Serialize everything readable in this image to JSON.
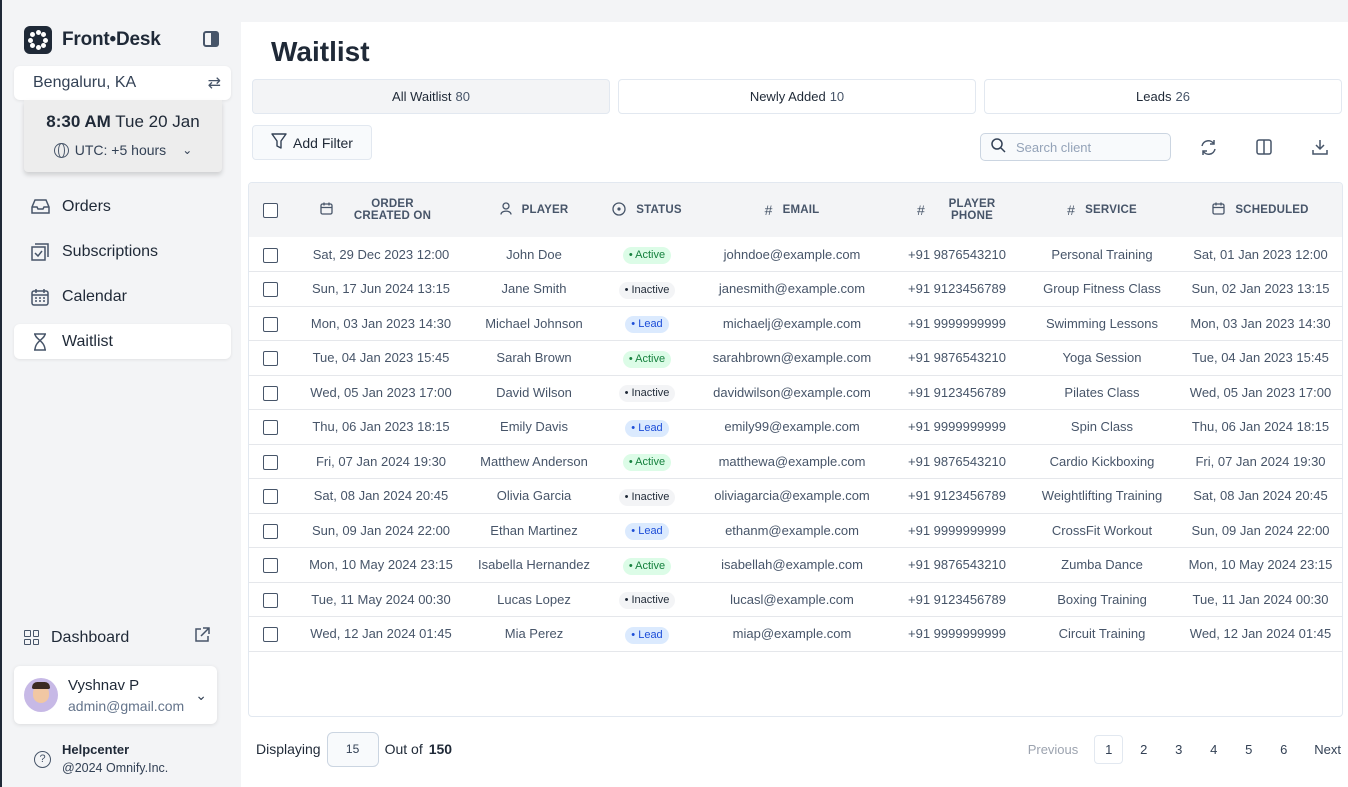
{
  "brand": {
    "name": "Front•Desk"
  },
  "location": "Bengaluru, KA",
  "clock": {
    "time": "8:30 AM",
    "date": "Tue 20 Jan",
    "timezone": "UTC: +5 hours"
  },
  "nav": [
    {
      "label": "Orders",
      "icon": "inbox-icon"
    },
    {
      "label": "Subscriptions",
      "icon": "subscriptions-icon"
    },
    {
      "label": "Calendar",
      "icon": "calendar-icon"
    },
    {
      "label": "Waitlist",
      "icon": "hourglass-icon",
      "active": true
    }
  ],
  "dashboard": {
    "label": "Dashboard"
  },
  "user": {
    "name": "Vyshnav P",
    "email": "admin@gmail.com"
  },
  "help": {
    "title": "Helpcenter",
    "subtitle": "@2024 Omnify.Inc."
  },
  "page": {
    "title": "Waitlist"
  },
  "tabs": [
    {
      "label": "All Waitlist",
      "count": "80",
      "active": true
    },
    {
      "label": "Newly Added",
      "count": "10"
    },
    {
      "label": "Leads",
      "count": "26"
    }
  ],
  "toolbar": {
    "filter_label": "Add Filter",
    "search_placeholder": "Search client"
  },
  "table": {
    "headers": [
      "ORDER CREATED ON",
      "PLAYER",
      "STATUS",
      "EMAIL",
      "PLAYER PHONE",
      "SERVICE",
      "SCHEDULED"
    ],
    "rows": [
      [
        "Sat, 29 Dec 2023 12:00",
        "John Doe",
        "Active",
        "johndoe@example.com",
        "+91 9876543210",
        "Personal Training",
        "Sat, 01 Jan 2023 12:00"
      ],
      [
        "Sun, 17 Jun 2024 13:15",
        "Jane Smith",
        "Inactive",
        "janesmith@example.com",
        "+91 9123456789",
        "Group Fitness Class",
        "Sun, 02 Jan 2023 13:15"
      ],
      [
        "Mon, 03 Jan 2023 14:30",
        "Michael Johnson",
        "Lead",
        "michaelj@example.com",
        "+91 9999999999",
        "Swimming Lessons",
        "Mon, 03 Jan 2023 14:30"
      ],
      [
        "Tue, 04 Jan 2023 15:45",
        "Sarah Brown",
        "Active",
        "sarahbrown@example.com",
        "+91 9876543210",
        "Yoga Session",
        "Tue, 04 Jan 2023 15:45"
      ],
      [
        "Wed, 05 Jan 2023 17:00",
        "David Wilson",
        "Inactive",
        "davidwilson@example.com",
        "+91 9123456789",
        "Pilates Class",
        "Wed, 05 Jan 2023 17:00"
      ],
      [
        "Thu, 06 Jan 2023 18:15",
        "Emily Davis",
        "Lead",
        "emily99@example.com",
        "+91 9999999999",
        "Spin Class",
        "Thu, 06 Jan 2024 18:15"
      ],
      [
        "Fri, 07 Jan 2024 19:30",
        "Matthew Anderson",
        "Active",
        "matthewa@example.com",
        "+91 9876543210",
        "Cardio Kickboxing",
        "Fri, 07 Jan 2024 19:30"
      ],
      [
        "Sat, 08 Jan 2024 20:45",
        "Olivia Garcia",
        "Inactive",
        "oliviagarcia@example.com",
        "+91 9123456789",
        "Weightlifting Training",
        "Sat, 08 Jan 2024 20:45"
      ],
      [
        "Sun, 09 Jan 2024 22:00",
        "Ethan Martinez",
        "Lead",
        "ethanm@example.com",
        "+91 9999999999",
        "CrossFit Workout",
        "Sun, 09 Jan 2024 22:00"
      ],
      [
        "Mon, 10 May 2024 23:15",
        "Isabella Hernandez",
        "Active",
        "isabellah@example.com",
        "+91 9876543210",
        "Zumba Dance",
        "Mon, 10 May 2024 23:15"
      ],
      [
        "Tue, 11 May 2024 00:30",
        "Lucas Lopez",
        "Inactive",
        "lucasl@example.com",
        "+91 9123456789",
        "Boxing Training",
        "Tue, 11 Jan 2024 00:30"
      ],
      [
        "Wed, 12 Jan 2024 01:45",
        "Mia Perez",
        "Lead",
        "miap@example.com",
        "+91 9999999999",
        "Circuit Training",
        "Wed, 12 Jan 2024 01:45"
      ]
    ]
  },
  "footer": {
    "displaying_label": "Displaying",
    "displaying_value": "15",
    "out_of_label": "Out of",
    "total": "150"
  },
  "pagination": {
    "previous": "Previous",
    "next": "Next",
    "pages": [
      "1",
      "2",
      "3",
      "4",
      "5",
      "6"
    ],
    "current": "1"
  }
}
